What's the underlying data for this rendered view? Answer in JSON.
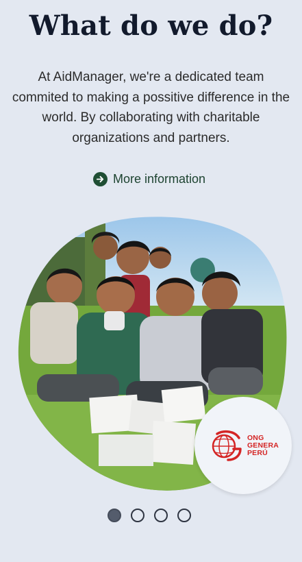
{
  "section": {
    "title": "What do we do?",
    "description": "At AidManager, we're a dedicated team commited to making a possitive difference in the world. By collaborating with charitable organizations and partners.",
    "more_label": "More information"
  },
  "partner": {
    "logo_text_line1": "ONG",
    "logo_text_line2": "GENERA",
    "logo_text_line3": "PERÚ"
  },
  "carousel": {
    "slide_count": 4,
    "active_index": 0
  },
  "colors": {
    "background": "#e3e8f1",
    "title": "#121a2c",
    "accent_green": "#1f4e34",
    "logo_red": "#d42525"
  },
  "icons": {
    "more_icon": "arrow-right-circle-icon",
    "partner_icon": "globe-g-logo-icon"
  }
}
